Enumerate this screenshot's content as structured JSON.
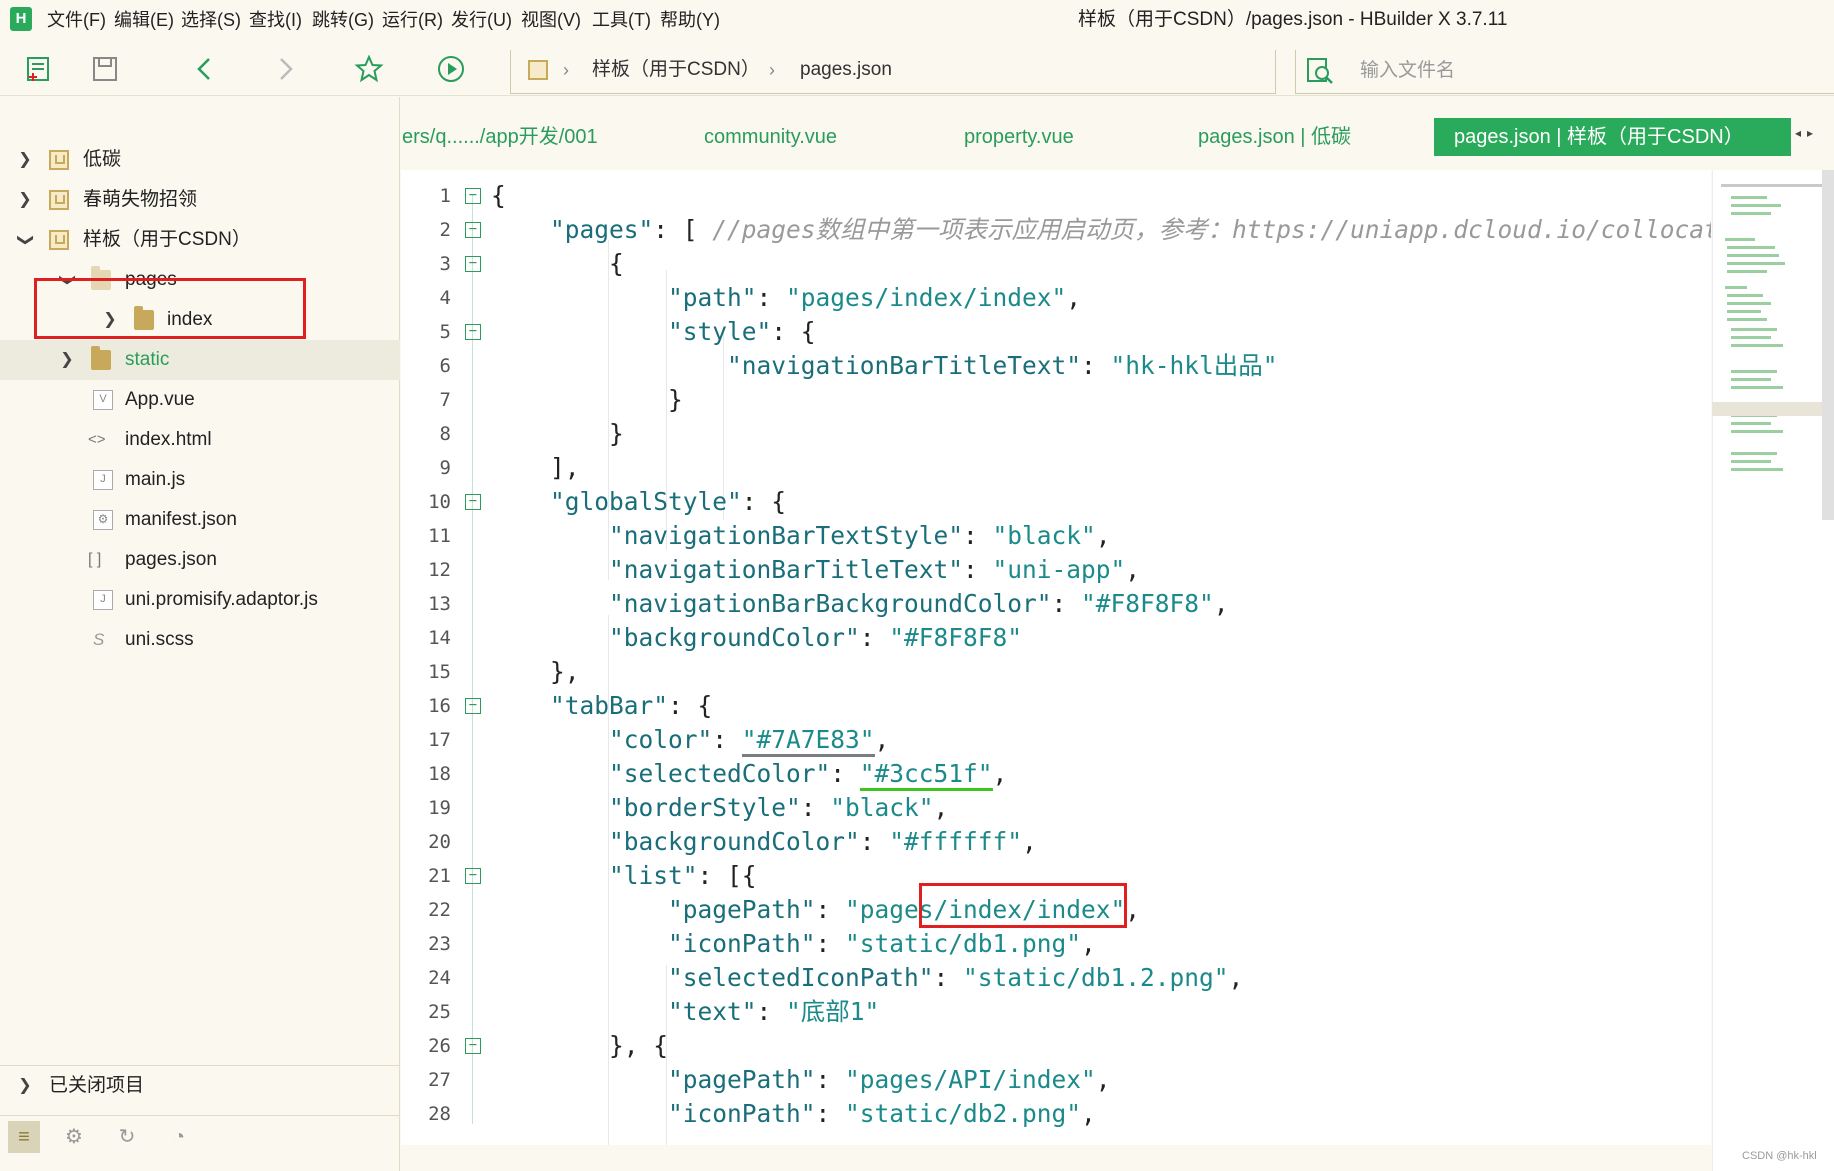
{
  "menubar": {
    "logo_text": "H",
    "items": [
      "文件(F)",
      "编辑(E)",
      "选择(S)",
      "查找(I)",
      "跳转(G)",
      "运行(R)",
      "发行(U)",
      "视图(V)",
      "工具(T)",
      "帮助(Y)"
    ],
    "window_title": "样板（用于CSDN）/pages.json - HBuilder X 3.7.11"
  },
  "toolbar": {
    "icons": [
      "new-file-icon",
      "save-icon",
      "back-icon",
      "forward-icon",
      "favorite-icon",
      "run-icon"
    ],
    "breadcrumb": [
      "样板（用于CSDN）",
      "pages.json"
    ],
    "search_placeholder": "输入文件名"
  },
  "sidebar": {
    "items": [
      {
        "label": "低碳",
        "type": "project",
        "depth": 0,
        "chevron": "right"
      },
      {
        "label": "春萌失物招领",
        "type": "project",
        "depth": 0,
        "chevron": "right"
      },
      {
        "label": "样板（用于CSDN）",
        "type": "project",
        "depth": 0,
        "chevron": "down"
      },
      {
        "label": "pages",
        "type": "folder",
        "depth": 1,
        "chevron": "down"
      },
      {
        "label": "index",
        "type": "folder",
        "depth": 2,
        "chevron": "right"
      },
      {
        "label": "static",
        "type": "folder",
        "depth": 1,
        "chevron": "right"
      },
      {
        "label": "App.vue",
        "type": "file",
        "depth": 1,
        "glyph": "V"
      },
      {
        "label": "index.html",
        "type": "file",
        "depth": 1,
        "glyph": "<>"
      },
      {
        "label": "main.js",
        "type": "file",
        "depth": 1,
        "glyph": "J"
      },
      {
        "label": "manifest.json",
        "type": "file",
        "depth": 1,
        "glyph": "⚙"
      },
      {
        "label": "pages.json",
        "type": "file",
        "depth": 1,
        "glyph": "[ ]"
      },
      {
        "label": "uni.promisify.adaptor.js",
        "type": "file",
        "depth": 1,
        "glyph": "J"
      },
      {
        "label": "uni.scss",
        "type": "file",
        "depth": 1,
        "glyph": "S"
      }
    ],
    "closed_projects_label": "已关闭项目"
  },
  "tabs": [
    {
      "label": "ers/q....../app开发/001",
      "active": false
    },
    {
      "label": "community.vue",
      "active": false
    },
    {
      "label": "property.vue",
      "active": false
    },
    {
      "label": "pages.json | 低碳",
      "active": false
    },
    {
      "label": "pages.json | 样板（用于CSDN）",
      "active": true
    }
  ],
  "colors": {
    "accent": "#2AAA5B",
    "sidebar_bg": "#FAF8EF",
    "highlight_box": "#E02020",
    "code_key": "#1A6E7A",
    "code_string": "#1C8A8A",
    "comment": "#999999",
    "swatch_color": "#7A7E83",
    "swatch_selected": "#3cc51f"
  },
  "editor": {
    "lines": [
      {
        "n": 1,
        "fold": "box",
        "text": "{"
      },
      {
        "n": 2,
        "fold": "box",
        "text": "    \"pages\": [ //pages数组中第一项表示应用启动页，参考：https://uniapp.dcloud.io/collocat"
      },
      {
        "n": 3,
        "fold": "box",
        "text": "        {"
      },
      {
        "n": 4,
        "fold": "",
        "text": "            \"path\": \"pages/index/index\","
      },
      {
        "n": 5,
        "fold": "box",
        "text": "            \"style\": {"
      },
      {
        "n": 6,
        "fold": "",
        "text": "                \"navigationBarTitleText\": \"hk-hkl出品\""
      },
      {
        "n": 7,
        "fold": "end",
        "text": "            }"
      },
      {
        "n": 8,
        "fold": "end",
        "text": "        }"
      },
      {
        "n": 9,
        "fold": "end",
        "text": "    ],"
      },
      {
        "n": 10,
        "fold": "box",
        "text": "    \"globalStyle\": {"
      },
      {
        "n": 11,
        "fold": "",
        "text": "        \"navigationBarTextStyle\": \"black\","
      },
      {
        "n": 12,
        "fold": "",
        "text": "        \"navigationBarTitleText\": \"uni-app\","
      },
      {
        "n": 13,
        "fold": "",
        "text": "        \"navigationBarBackgroundColor\": \"#F8F8F8\","
      },
      {
        "n": 14,
        "fold": "",
        "text": "        \"backgroundColor\": \"#F8F8F8\""
      },
      {
        "n": 15,
        "fold": "end",
        "text": "    },"
      },
      {
        "n": 16,
        "fold": "box",
        "text": "    \"tabBar\": {"
      },
      {
        "n": 17,
        "fold": "",
        "text": "        \"color\": \"#7A7E83\","
      },
      {
        "n": 18,
        "fold": "",
        "text": "        \"selectedColor\": \"#3cc51f\","
      },
      {
        "n": 19,
        "fold": "",
        "text": "        \"borderStyle\": \"black\","
      },
      {
        "n": 20,
        "fold": "",
        "text": "        \"backgroundColor\": \"#ffffff\","
      },
      {
        "n": 21,
        "fold": "box",
        "text": "        \"list\": [{"
      },
      {
        "n": 22,
        "fold": "",
        "text": "            \"pagePath\": \"pages/index/index\","
      },
      {
        "n": 23,
        "fold": "",
        "text": "            \"iconPath\": \"static/db1.png\","
      },
      {
        "n": 24,
        "fold": "",
        "text": "            \"selectedIconPath\": \"static/db1.2.png\","
      },
      {
        "n": 25,
        "fold": "end",
        "text": "            \"text\": \"底部1\""
      },
      {
        "n": 26,
        "fold": "box",
        "text": "        }, {"
      },
      {
        "n": 27,
        "fold": "",
        "text": "            \"pagePath\": \"pages/API/index\","
      },
      {
        "n": 28,
        "fold": "",
        "text": "            \"iconPath\": \"static/db2.png\","
      }
    ]
  },
  "watermark": "CSDN @hk-hkl"
}
